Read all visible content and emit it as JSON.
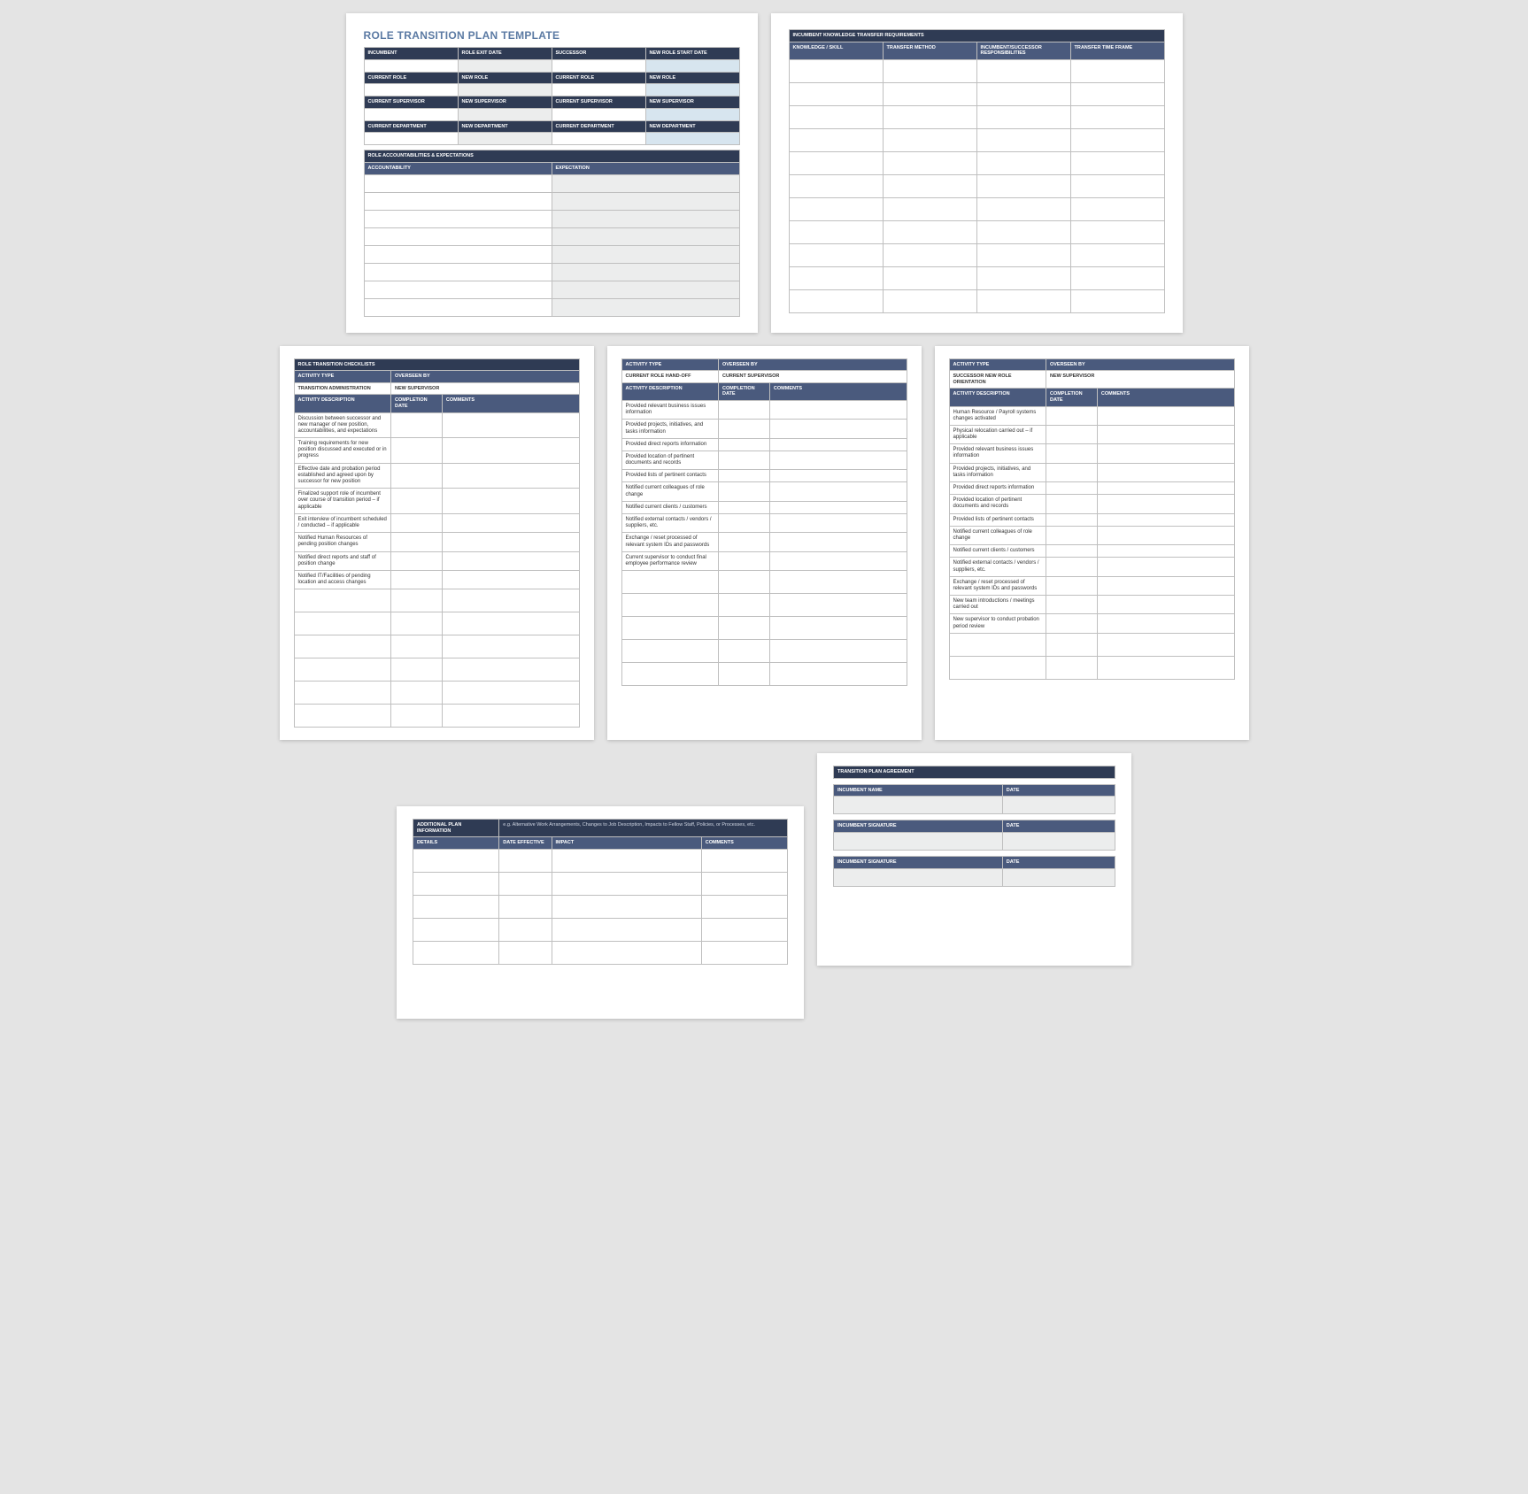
{
  "page1": {
    "title": "ROLE TRANSITION PLAN TEMPLATE",
    "headers1": {
      "a": "INCUMBENT",
      "b": "ROLE EXIT DATE",
      "c": "SUCCESSOR",
      "d": "NEW ROLE START DATE"
    },
    "headers2": {
      "a": "CURRENT ROLE",
      "b": "NEW ROLE",
      "c": "CURRENT ROLE",
      "d": "NEW ROLE"
    },
    "headers3": {
      "a": "CURRENT SUPERVISOR",
      "b": "NEW SUPERVISOR",
      "c": "CURRENT SUPERVISOR",
      "d": "NEW SUPERVISOR"
    },
    "headers4": {
      "a": "CURRENT DEPARTMENT",
      "b": "NEW DEPARTMENT",
      "c": "CURRENT DEPARTMENT",
      "d": "NEW DEPARTMENT"
    },
    "section2": "ROLE ACCOUNTABILITIES & EXPECTATIONS",
    "cols2": {
      "a": "ACCOUNTABILITY",
      "b": "EXPECTATION"
    }
  },
  "page2": {
    "section": "INCUMBENT KNOWLEDGE TRANSFER REQUIREMENTS",
    "cols": {
      "a": "KNOWLEDGE / SKILL",
      "b": "TRANSFER METHOD",
      "c": "INCUMBENT/SUCCESSOR RESPONSIBILITIES",
      "d": "TRANSFER TIME FRAME"
    }
  },
  "page3": {
    "section": "ROLE TRANSITION CHECKLISTS",
    "row1": {
      "a": "ACTIVITY TYPE",
      "b": "OVERSEEN BY"
    },
    "row2": {
      "a": "TRANSITION ADMINISTRATION",
      "b": "NEW SUPERVISOR"
    },
    "cols": {
      "a": "ACTIVITY DESCRIPTION",
      "b": "COMPLETION DATE",
      "c": "COMMENTS"
    },
    "items": [
      "Discussion between successor and new manager of new position, accountabilities, and expectations",
      "Training requirements for new position discussed and executed or in progress",
      "Effective date and probation period established and agreed upon by successor for new position",
      "Finalized support role of incumbent over course of transition period – if applicable",
      "Exit interview of incumbent scheduled / conducted – if applicable",
      "Notified Human Resources of pending position changes",
      "Notified direct reports and staff of position change",
      "Notified IT/Facilities of pending location and access changes"
    ]
  },
  "page4": {
    "row1": {
      "a": "ACTIVITY TYPE",
      "b": "OVERSEEN BY"
    },
    "row2": {
      "a": "CURRENT ROLE HAND-OFF",
      "b": "CURRENT SUPERVISOR"
    },
    "cols": {
      "a": "ACTIVITY DESCRIPTION",
      "b": "COMPLETION DATE",
      "c": "COMMENTS"
    },
    "items": [
      "Provided relevant business issues information",
      "Provided projects, initiatives, and tasks information",
      "Provided direct reports information",
      "Provided location of pertinent documents and records",
      "Provided lists of pertinent contacts",
      "Notified current colleagues of role change",
      "Notified current clients / customers",
      "Notified external contacts / vendors / suppliers, etc.",
      "Exchange / reset processed of relevant system IDs and passwords",
      "Current supervisor to conduct final employee performance review"
    ]
  },
  "page5": {
    "row1": {
      "a": "ACTIVITY TYPE",
      "b": "OVERSEEN BY"
    },
    "row2": {
      "a": "SUCCESSOR NEW ROLE ORIENTATION",
      "b": "NEW SUPERVISOR"
    },
    "cols": {
      "a": "ACTIVITY DESCRIPTION",
      "b": "COMPLETION DATE",
      "c": "COMMENTS"
    },
    "items": [
      "Human Resource / Payroll systems changes activated",
      "Physical relocation carried out – if applicable",
      "Provided relevant business issues information",
      "Provided projects, initiatives, and tasks information",
      "Provided direct reports information",
      "Provided location of pertinent documents and records",
      "Provided lists of pertinent contacts",
      "Notified current colleagues of role change",
      "Notified current clients / customers",
      "Notified external contacts / vendors / suppliers, etc.",
      "Exchange / reset processed of relevant system IDs and passwords",
      "New team introductions / meetings carried out",
      "New supervisor to conduct probation period review"
    ]
  },
  "page6": {
    "section": "ADDITIONAL PLAN INFORMATION",
    "note": "e.g. Alternative Work Arrangements, Changes to Job Description, Impacts to Fellow Staff, Policies, or Processes, etc.",
    "cols": {
      "a": "DETAILS",
      "b": "DATE EFFECTIVE",
      "c": "IMPACT",
      "d": "COMMENTS"
    }
  },
  "page7": {
    "section": "TRANSITION PLAN AGREEMENT",
    "rows": [
      {
        "a": "INCUMBENT NAME",
        "b": "DATE"
      },
      {
        "a": "INCUMBENT SIGNATURE",
        "b": "DATE"
      },
      {
        "a": "INCUMBENT SIGNATURE",
        "b": "DATE"
      }
    ]
  }
}
